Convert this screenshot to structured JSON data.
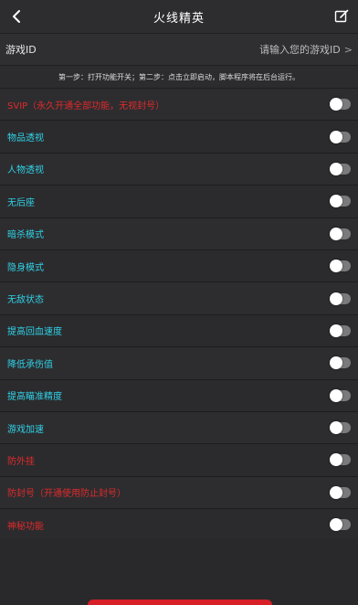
{
  "header": {
    "title": "火线精英",
    "back_icon": "chevron-left-icon",
    "edit_icon": "edit-icon"
  },
  "game_id": {
    "label": "游戏ID",
    "placeholder": "请输入您的游戏ID",
    "chevron": ">"
  },
  "steps_text": "第一步：打开功能开关；第二步：点击立即启动，脚本程序将在后台运行。",
  "features": [
    {
      "label": "SVIP（永久开通全部功能，无视封号）",
      "color": "red",
      "enabled": false
    },
    {
      "label": "物品透视",
      "color": "cyan",
      "enabled": false
    },
    {
      "label": "人物透视",
      "color": "cyan",
      "enabled": false
    },
    {
      "label": "无后座",
      "color": "cyan",
      "enabled": false
    },
    {
      "label": "暗杀模式",
      "color": "cyan",
      "enabled": false
    },
    {
      "label": "隐身模式",
      "color": "cyan",
      "enabled": false
    },
    {
      "label": "无敌状态",
      "color": "cyan",
      "enabled": false
    },
    {
      "label": "提高回血速度",
      "color": "cyan",
      "enabled": false
    },
    {
      "label": "降低承伤值",
      "color": "cyan",
      "enabled": false
    },
    {
      "label": "提高瞄准精度",
      "color": "cyan",
      "enabled": false
    },
    {
      "label": "游戏加速",
      "color": "cyan",
      "enabled": false
    },
    {
      "label": "防外挂",
      "color": "red",
      "enabled": false
    },
    {
      "label": "防封号（开通使用防止封号）",
      "color": "red",
      "enabled": false
    },
    {
      "label": "神秘功能",
      "color": "red",
      "enabled": false
    }
  ],
  "colors": {
    "cyan": "#2fd2e6",
    "red": "#e02a2a",
    "start_button": "#d61f26",
    "background": "#2c2c2e"
  }
}
